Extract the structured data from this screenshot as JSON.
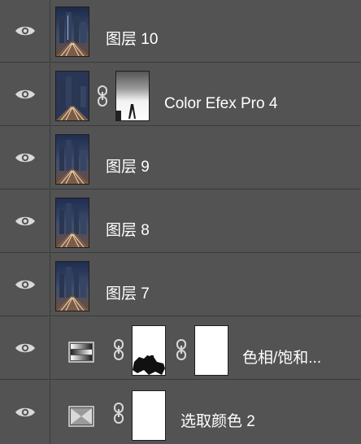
{
  "layers_panel": {
    "layers": [
      {
        "name": "图层 10",
        "visible": true,
        "type": "pixel",
        "thumbnail": "night-city-photo"
      },
      {
        "name": "Color Efex Pro 4",
        "visible": true,
        "type": "pixel-with-mask",
        "thumbnail": "night-city-photo",
        "mask": "grey-white-mask"
      },
      {
        "name": "图层 9",
        "visible": true,
        "type": "pixel",
        "thumbnail": "night-city-photo"
      },
      {
        "name": "图层 8",
        "visible": true,
        "type": "pixel",
        "thumbnail": "night-city-photo"
      },
      {
        "name": "图层 7",
        "visible": true,
        "type": "pixel",
        "thumbnail": "night-city-photo"
      },
      {
        "name": "色相/饱和...",
        "visible": true,
        "type": "adjustment",
        "icon": "hue-saturation-icon",
        "mask": "black-white-mask"
      },
      {
        "name": "选取颜色 2",
        "visible": true,
        "type": "adjustment",
        "icon": "selective-color-icon",
        "mask": "white-mask"
      }
    ]
  },
  "colors": {
    "panel_background": "#535353",
    "divider": "#3b3b3b",
    "text": "#ffffff",
    "icon": "#d9d9d9"
  }
}
